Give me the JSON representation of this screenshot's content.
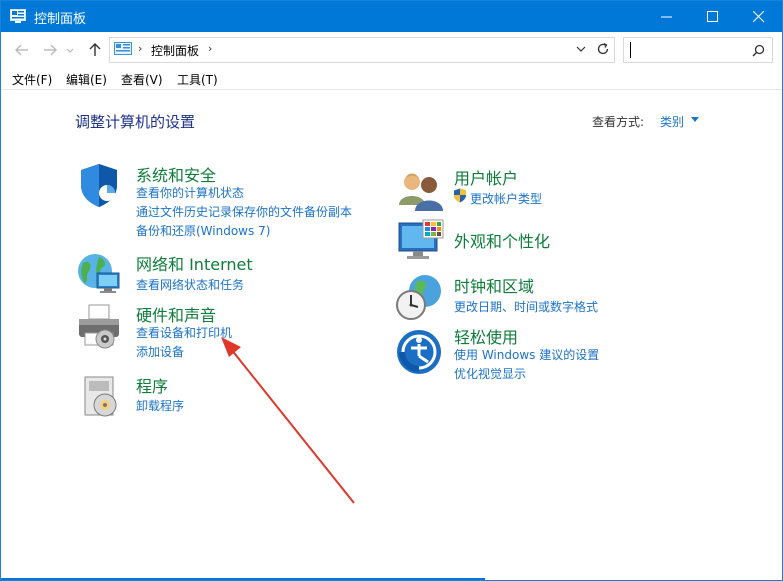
{
  "window": {
    "title": "控制面板"
  },
  "address": {
    "crumb": "控制面板",
    "sep1": "›",
    "sep2": "›",
    "search_placeholder": ""
  },
  "menu": [
    "文件(F)",
    "编辑(E)",
    "查看(V)",
    "工具(T)"
  ],
  "main": {
    "heading": "调整计算机的设置",
    "view_by_label": "查看方式:",
    "view_by_value": "类别"
  },
  "categories": [
    {
      "title": "系统和安全",
      "icon": "shield-icon",
      "links": [
        "查看你的计算机状态",
        "通过文件历史记录保存你的文件备份副本",
        "备份和还原(Windows 7)"
      ]
    },
    {
      "title": "网络和 Internet",
      "icon": "globe-network-icon",
      "links": [
        "查看网络状态和任务"
      ]
    },
    {
      "title": "硬件和声音",
      "icon": "printer-icon",
      "links": [
        "查看设备和打印机",
        "添加设备"
      ]
    },
    {
      "title": "程序",
      "icon": "programs-icon",
      "links": [
        "卸载程序"
      ]
    },
    {
      "title": "用户帐户",
      "icon": "users-icon",
      "links": [
        "更改帐户类型"
      ]
    },
    {
      "title": "外观和个性化",
      "icon": "monitor-icon",
      "links": []
    },
    {
      "title": "时钟和区域",
      "icon": "clock-globe-icon",
      "links": [
        "更改日期、时间或数字格式"
      ]
    },
    {
      "title": "轻松使用",
      "icon": "ease-of-access-icon",
      "links": [
        "使用 Windows 建议的设置",
        "优化视觉显示"
      ]
    }
  ],
  "colors": {
    "titlebar": "#0078d7",
    "link": "#1c73c9",
    "category_title": "#0e7d3a",
    "heading": "#1e3287",
    "arrow": "#e0392b"
  }
}
